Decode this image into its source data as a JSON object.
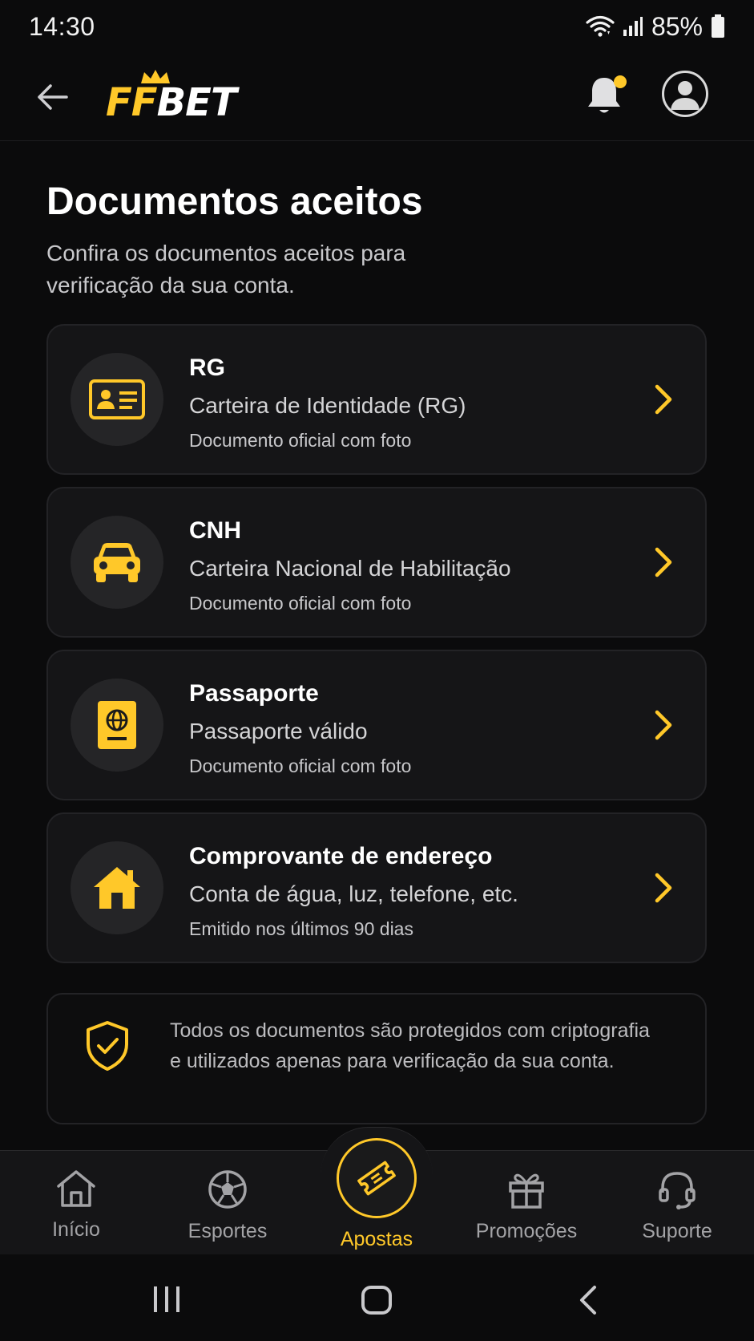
{
  "status_bar": {
    "time": "14:30",
    "battery": "85%"
  },
  "header": {
    "logo_ff": "FF",
    "logo_bet": "BET",
    "icons": {
      "back": "arrow-left-icon",
      "notifications": "bell-icon",
      "profile": "user-avatar-icon"
    },
    "notification_dot_color": "#ffc829"
  },
  "page": {
    "title": "Documentos aceitos",
    "subtitle": "Confira os documentos aceitos para verificação da sua conta."
  },
  "documents": [
    {
      "title": "RG",
      "description": "Carteira de Identidade (RG)",
      "note": "Documento oficial com foto",
      "icon": "id-card-icon"
    },
    {
      "title": "CNH",
      "description": "Carteira Nacional de Habilitação",
      "note": "Documento oficial com foto",
      "icon": "car-icon"
    },
    {
      "title": "Passaporte",
      "description": "Passaporte válido",
      "note": "Documento oficial com foto",
      "icon": "passport-icon"
    },
    {
      "title": "Comprovante de endereço",
      "description": "Conta de água, luz, telefone, etc.",
      "note": "Emitido nos últimos 90 dias",
      "icon": "house-icon"
    }
  ],
  "info": {
    "text": "Todos os documentos são protegidos com criptografia e utilizados apenas para verificação da sua conta.",
    "icon": "shield-check-icon"
  },
  "bottom_nav": [
    {
      "label": "Início",
      "icon": "home-icon",
      "active": false
    },
    {
      "label": "Esportes",
      "icon": "soccer-ball-icon",
      "active": false
    },
    {
      "label": "Apostas",
      "icon": "ticket-icon",
      "active": true
    },
    {
      "label": "Promoções",
      "icon": "gift-icon",
      "active": false
    },
    {
      "label": "Suporte",
      "icon": "headset-icon",
      "active": false
    }
  ],
  "colors": {
    "accent": "#ffc829",
    "background": "#0b0b0c",
    "card": "#151517"
  }
}
